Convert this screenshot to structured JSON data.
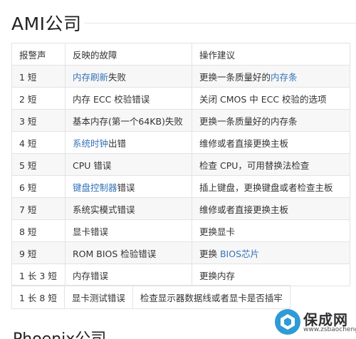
{
  "title": "AMI公司",
  "table": {
    "headers": [
      "报警声",
      "反映的故障",
      "操作建议"
    ],
    "rows": [
      {
        "beep": "1 短",
        "fault": [
          {
            "t": "内存刷新",
            "link": true
          },
          {
            "t": "失败"
          }
        ],
        "advice": [
          {
            "t": "更换一条质量好的"
          },
          {
            "t": "内存条",
            "link": true
          }
        ]
      },
      {
        "beep": "2 短",
        "fault": [
          {
            "t": "内存 ECC 校验错误"
          }
        ],
        "advice": [
          {
            "t": "关闭 CMOS 中 ECC 校验的选项"
          }
        ]
      },
      {
        "beep": "3 短",
        "fault": [
          {
            "t": "基本内存(第一个64KB)失败"
          }
        ],
        "advice": [
          {
            "t": "更换一条质量好的内存条"
          }
        ]
      },
      {
        "beep": "4 短",
        "fault": [
          {
            "t": "系统时钟",
            "link": true
          },
          {
            "t": "出错"
          }
        ],
        "advice": [
          {
            "t": "维修或者直接更换主板"
          }
        ]
      },
      {
        "beep": "5 短",
        "fault": [
          {
            "t": "CPU 错误"
          }
        ],
        "advice": [
          {
            "t": "检查 CPU，可用替换法检查"
          }
        ]
      },
      {
        "beep": "6 短",
        "fault": [
          {
            "t": "键盘控制器",
            "link": true
          },
          {
            "t": "错误"
          }
        ],
        "advice": [
          {
            "t": "插上键盘，更换键盘或者检查主板"
          }
        ]
      },
      {
        "beep": "7 短",
        "fault": [
          {
            "t": "系统实模式错误"
          }
        ],
        "advice": [
          {
            "t": "维修或者直接更换主板"
          }
        ]
      },
      {
        "beep": "8 短",
        "fault": [
          {
            "t": "显卡错误"
          }
        ],
        "advice": [
          {
            "t": "更换显卡"
          }
        ]
      },
      {
        "beep": "9 短",
        "fault": [
          {
            "t": "ROM BIOS 检验错误"
          }
        ],
        "advice": [
          {
            "t": "更换 "
          },
          {
            "t": "BIOS芯片",
            "link": true
          }
        ]
      },
      {
        "beep": "1 长 3 短",
        "fault": [
          {
            "t": "内存错误"
          }
        ],
        "advice": [
          {
            "t": "更换内存"
          }
        ]
      }
    ]
  },
  "extra_row": {
    "beep": "1 长 8 短",
    "fault": "显卡测试错误",
    "advice": "检查显示器数据线或者显卡是否插牢"
  },
  "next_heading": "Phoenix公司",
  "watermark": {
    "name": "保成网",
    "url": "www.zsbaocheng.net",
    "accent": "#2e9bd6"
  },
  "colors": {
    "link": "#3573b9",
    "row_alt": "#f7f7f7",
    "border": "#e3e3e3"
  }
}
